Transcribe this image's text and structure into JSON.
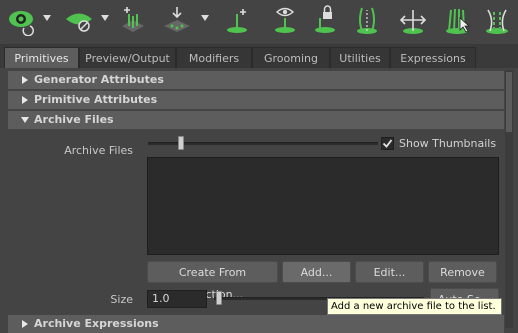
{
  "toolbar": {
    "tools": [
      {
        "icon": "eye-rotate-icon"
      },
      {
        "icon": "hide-eye-icon"
      },
      {
        "icon": "add-guides-icon"
      },
      {
        "icon": "move-guides-icon"
      },
      {
        "icon": "add-stroke-icon"
      },
      {
        "icon": "show-guides-icon"
      },
      {
        "icon": "lock-guides-icon"
      },
      {
        "icon": "select-strands-icon"
      },
      {
        "icon": "scale-strands-icon"
      },
      {
        "icon": "select-guides-icon"
      },
      {
        "icon": "collapse-strands-icon"
      }
    ],
    "colors": {
      "green": "#4fc24f",
      "white": "#d8d8d8"
    }
  },
  "tabs": [
    {
      "label": "Primitives",
      "active": true
    },
    {
      "label": "Preview/Output",
      "active": false
    },
    {
      "label": "Modifiers",
      "active": false
    },
    {
      "label": "Grooming",
      "active": false
    },
    {
      "label": "Utilities",
      "active": false
    },
    {
      "label": "Expressions",
      "active": false
    }
  ],
  "sections": {
    "generator": {
      "title": "Generator Attributes",
      "expanded": false
    },
    "primitive": {
      "title": "Primitive Attributes",
      "expanded": false
    },
    "archive": {
      "title": "Archive Files",
      "expanded": true
    },
    "expressions": {
      "title": "Archive Expressions",
      "expanded": false
    }
  },
  "archive_files": {
    "label": "Archive Files",
    "show_thumbnails_label": "Show Thumbnails",
    "show_thumbnails_checked": true,
    "slider_value": 0.1,
    "buttons": {
      "create": "Create From Selection...",
      "add": "Add...",
      "edit": "Edit...",
      "remove": "Remove"
    },
    "size_label": "Size",
    "size_value": "1.0",
    "size_slider_value": 0.0,
    "partial_button": "Auto Se..."
  },
  "tooltip": "Add a new archive file to the list."
}
